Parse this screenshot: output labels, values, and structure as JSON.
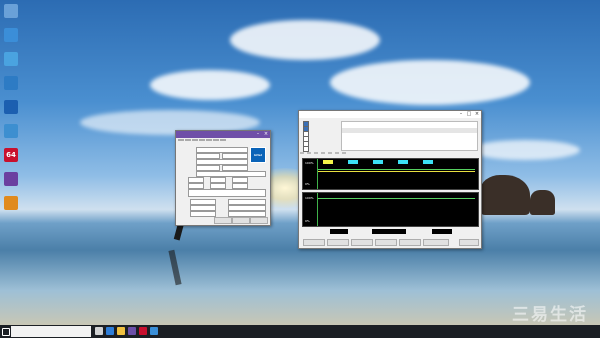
{
  "taskbar": {
    "search_placeholder": "",
    "tray_time": "",
    "tray_date": ""
  },
  "desktop_icons": [
    {
      "label": "",
      "icon": "recycle-bin-icon",
      "color": "#6aa1d8"
    },
    {
      "label": "",
      "icon": "computer-icon",
      "color": "#3b8ed8"
    },
    {
      "label": "",
      "icon": "app-icon",
      "color": "#4aa3e0"
    },
    {
      "label": "",
      "icon": "network-icon",
      "color": "#2d7bc4"
    },
    {
      "label": "",
      "icon": "benchmark-icon",
      "color": "#1c5fb0"
    },
    {
      "label": "",
      "icon": "monitor-icon",
      "color": "#3d8fd0"
    },
    {
      "label": "64",
      "icon": "aida64-icon",
      "color": "#c8102e"
    },
    {
      "label": "",
      "icon": "app-icon",
      "color": "#6b3fa0"
    },
    {
      "label": "",
      "icon": "tool-icon",
      "color": "#e08a1e"
    }
  ],
  "cpuz": {
    "tabs": [
      "",
      "",
      "",
      "",
      "",
      "",
      ""
    ],
    "processor_label": "",
    "name_value": "",
    "codename": "",
    "brand_logo_text": "intel",
    "footer_left": "",
    "tools_label": "",
    "validate_label": "",
    "ok_label": ""
  },
  "stability": {
    "title": "",
    "options": [
      "",
      "",
      "",
      "",
      "",
      ""
    ],
    "date_time_header": "",
    "status_header": "",
    "date_value": "",
    "status_value": "",
    "tabs": [
      "",
      "",
      "",
      "",
      "",
      "",
      ""
    ],
    "graph1_top": "100%",
    "graph1_bottom": "0%",
    "graph2_title": "",
    "graph2_top": "100%",
    "graph2_bottom": "0%",
    "remaining_battery_label": "",
    "remaining_battery_value": "",
    "test_started_label": "",
    "test_started_value": "",
    "elapsed_label": "",
    "elapsed_value": "",
    "buttons": [
      "",
      "",
      "",
      "",
      "",
      ""
    ]
  },
  "watermark": "三易生活"
}
